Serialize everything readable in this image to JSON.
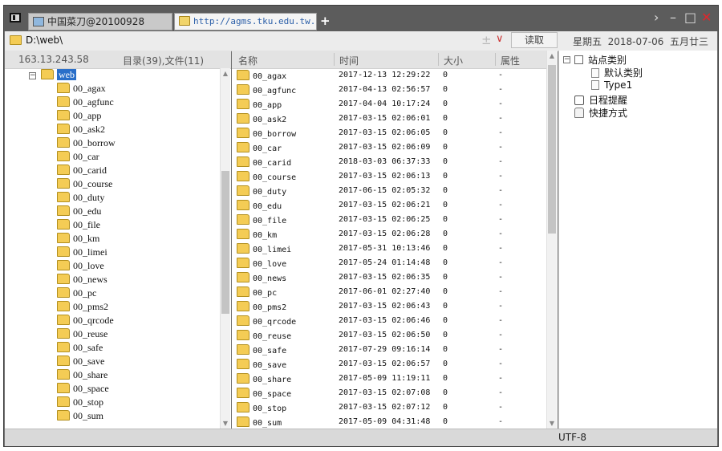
{
  "tabs": [
    {
      "title": "中国菜刀@20100928"
    },
    {
      "title": "http://agms.tku.edu.tw..."
    }
  ],
  "window_controls": {
    "nav": "›",
    "minimize": "–",
    "maximize": "□",
    "close": "✕",
    "new_tab": "+"
  },
  "address": {
    "path": "D:\\web\\",
    "add_symbol": "±",
    "drop_symbol": "∨",
    "read_button": "读取",
    "date_text": "星期五  2018-07-06  五月廿三"
  },
  "left": {
    "ip": "163.13.243.58",
    "count": "目录(39),文件(11)",
    "root": "web",
    "root_expander": "−",
    "folders": [
      "00_agax",
      "00_agfunc",
      "00_app",
      "00_ask2",
      "00_borrow",
      "00_car",
      "00_carid",
      "00_course",
      "00_duty",
      "00_edu",
      "00_file",
      "00_km",
      "00_limei",
      "00_love",
      "00_news",
      "00_pc",
      "00_pms2",
      "00_qrcode",
      "00_reuse",
      "00_safe",
      "00_save",
      "00_share",
      "00_space",
      "00_stop",
      "00_sum"
    ]
  },
  "list": {
    "headers": {
      "name": "名称",
      "time": "时间",
      "size": "大小",
      "attr": "属性"
    },
    "rows": [
      {
        "name": "00_agax",
        "time": "2017-12-13 12:29:22",
        "size": "0",
        "attr": "-"
      },
      {
        "name": "00_agfunc",
        "time": "2017-04-13 02:56:57",
        "size": "0",
        "attr": "-"
      },
      {
        "name": "00_app",
        "time": "2017-04-04 10:17:24",
        "size": "0",
        "attr": "-"
      },
      {
        "name": "00_ask2",
        "time": "2017-03-15 02:06:01",
        "size": "0",
        "attr": "-"
      },
      {
        "name": "00_borrow",
        "time": "2017-03-15 02:06:05",
        "size": "0",
        "attr": "-"
      },
      {
        "name": "00_car",
        "time": "2017-03-15 02:06:09",
        "size": "0",
        "attr": "-"
      },
      {
        "name": "00_carid",
        "time": "2018-03-03 06:37:33",
        "size": "0",
        "attr": "-"
      },
      {
        "name": "00_course",
        "time": "2017-03-15 02:06:13",
        "size": "0",
        "attr": "-"
      },
      {
        "name": "00_duty",
        "time": "2017-06-15 02:05:32",
        "size": "0",
        "attr": "-"
      },
      {
        "name": "00_edu",
        "time": "2017-03-15 02:06:21",
        "size": "0",
        "attr": "-"
      },
      {
        "name": "00_file",
        "time": "2017-03-15 02:06:25",
        "size": "0",
        "attr": "-"
      },
      {
        "name": "00_km",
        "time": "2017-03-15 02:06:28",
        "size": "0",
        "attr": "-"
      },
      {
        "name": "00_limei",
        "time": "2017-05-31 10:13:46",
        "size": "0",
        "attr": "-"
      },
      {
        "name": "00_love",
        "time": "2017-05-24 01:14:48",
        "size": "0",
        "attr": "-"
      },
      {
        "name": "00_news",
        "time": "2017-03-15 02:06:35",
        "size": "0",
        "attr": "-"
      },
      {
        "name": "00_pc",
        "time": "2017-06-01 02:27:40",
        "size": "0",
        "attr": "-"
      },
      {
        "name": "00_pms2",
        "time": "2017-03-15 02:06:43",
        "size": "0",
        "attr": "-"
      },
      {
        "name": "00_qrcode",
        "time": "2017-03-15 02:06:46",
        "size": "0",
        "attr": "-"
      },
      {
        "name": "00_reuse",
        "time": "2017-03-15 02:06:50",
        "size": "0",
        "attr": "-"
      },
      {
        "name": "00_safe",
        "time": "2017-07-29 09:16:14",
        "size": "0",
        "attr": "-"
      },
      {
        "name": "00_save",
        "time": "2017-03-15 02:06:57",
        "size": "0",
        "attr": "-"
      },
      {
        "name": "00_share",
        "time": "2017-05-09 11:19:11",
        "size": "0",
        "attr": "-"
      },
      {
        "name": "00_space",
        "time": "2017-03-15 02:07:08",
        "size": "0",
        "attr": "-"
      },
      {
        "name": "00_stop",
        "time": "2017-03-15 02:07:12",
        "size": "0",
        "attr": "-"
      },
      {
        "name": "00_sum",
        "time": "2017-05-09 04:31:48",
        "size": "0",
        "attr": "-"
      }
    ]
  },
  "right": {
    "expander": "−",
    "site_category": "站点类别",
    "default_category": "默认类别",
    "type1": "Type1",
    "schedule": "日程提醒",
    "shortcuts": "快捷方式"
  },
  "status": {
    "encoding": "UTF-8"
  },
  "icons": {
    "folder": "folder-icon",
    "close": "close-icon",
    "clock": "clock-icon",
    "hand": "hand-icon"
  },
  "colors": {
    "selection": "#2a6fc9",
    "folder": "#f4cc55",
    "close": "#e0262b",
    "frame": "#6f6f6f"
  }
}
